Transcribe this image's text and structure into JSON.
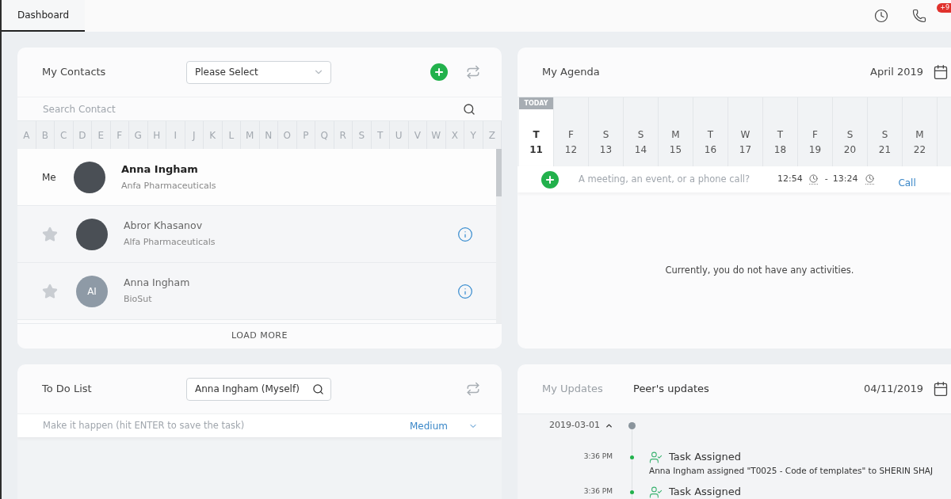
{
  "top_bar": {
    "tabs": [
      {
        "label": "Dashboard",
        "selected": true
      }
    ],
    "notification_badge": "+9"
  },
  "contacts": {
    "title": "My Contacts",
    "group_select": {
      "placeholder": "Please Select"
    },
    "search": {
      "placeholder": "Search Contact"
    },
    "letters": [
      "A",
      "B",
      "C",
      "D",
      "E",
      "F",
      "G",
      "H",
      "I",
      "J",
      "K",
      "L",
      "M",
      "N",
      "O",
      "P",
      "Q",
      "R",
      "S",
      "T",
      "U",
      "V",
      "W",
      "X",
      "Y",
      "Z"
    ],
    "rows": [
      {
        "kind": "me",
        "label": "Me",
        "avatar": {
          "kind": "photo"
        },
        "name": "Anna Ingham",
        "company": "Anfa Pharmaceuticals"
      },
      {
        "kind": "contact",
        "starred": false,
        "avatar": {
          "kind": "photo"
        },
        "name": "Abror Khasanov",
        "company": "Alfa Pharmaceuticals"
      },
      {
        "kind": "contact",
        "starred": false,
        "avatar": {
          "kind": "initials",
          "initials": "AI"
        },
        "name": "Anna Ingham",
        "company": "BioSut"
      }
    ],
    "load_more": "LOAD MORE"
  },
  "agenda": {
    "title": "My Agenda",
    "month": "April 2019",
    "days": [
      {
        "weekday": "T",
        "date": "11",
        "selected": true,
        "badge": "TODAY"
      },
      {
        "weekday": "F",
        "date": "12",
        "selected": false
      },
      {
        "weekday": "S",
        "date": "13",
        "selected": false
      },
      {
        "weekday": "S",
        "date": "14",
        "selected": false
      },
      {
        "weekday": "M",
        "date": "15",
        "selected": false
      },
      {
        "weekday": "T",
        "date": "16",
        "selected": false
      },
      {
        "weekday": "W",
        "date": "17",
        "selected": false
      },
      {
        "weekday": "T",
        "date": "18",
        "selected": false
      },
      {
        "weekday": "F",
        "date": "19",
        "selected": false
      },
      {
        "weekday": "S",
        "date": "20",
        "selected": false
      },
      {
        "weekday": "S",
        "date": "21",
        "selected": false
      },
      {
        "weekday": "M",
        "date": "22",
        "selected": false
      }
    ],
    "new_activity": {
      "placeholder": "A meeting, an event, or a phone call?",
      "start": "12:54",
      "separator": "-",
      "end": "13:24",
      "type": "Call"
    },
    "empty_message": "Currently, you do not have any activities."
  },
  "todo": {
    "title": "To Do List",
    "assignee": {
      "value": "Anna Ingham (Myself)"
    },
    "new_task": {
      "placeholder": "Make it happen (hit ENTER to save the task)",
      "priority": "Medium"
    }
  },
  "updates": {
    "tabs": [
      {
        "label": "My Updates",
        "selected": false
      },
      {
        "label": "Peer's updates",
        "selected": true
      }
    ],
    "date": "04/11/2019",
    "groups": [
      {
        "date": "2019-03-01",
        "expanded": true,
        "entries": [
          {
            "time": "3:36 PM",
            "title": "Task Assigned",
            "description": "Anna Ingham assigned \"T0025 - Code of templates\" to SHERIN SHAJ"
          },
          {
            "time": "3:36 PM",
            "title": "Task Assigned"
          }
        ]
      }
    ]
  }
}
